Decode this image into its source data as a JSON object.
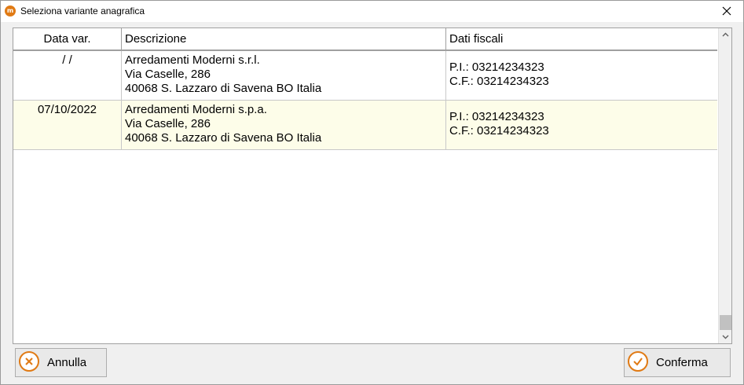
{
  "window": {
    "title": "Seleziona variante anagrafica"
  },
  "table": {
    "columns": [
      "Data var.",
      "Descrizione",
      "Dati fiscali"
    ],
    "rows": [
      {
        "date": " /  /",
        "description": [
          "Arredamenti Moderni s.r.l.",
          "Via Caselle, 286",
          "40068 S. Lazzaro di Savena BO Italia"
        ],
        "fiscal": [
          "P.I.: 03214234323",
          "C.F.: 03214234323"
        ],
        "selected": false
      },
      {
        "date": "07/10/2022",
        "description": [
          "Arredamenti Moderni s.p.a.",
          "Via Caselle, 286",
          "40068 S. Lazzaro di Savena BO Italia"
        ],
        "fiscal": [
          "P.I.: 03214234323",
          "C.F.: 03214234323"
        ],
        "selected": true
      }
    ]
  },
  "buttons": {
    "cancel_label": "Annulla",
    "confirm_label": "Conferma"
  },
  "colors": {
    "accent": "#e07a14",
    "selected_row": "#fdfde9",
    "grid_border": "#a0a0a0"
  }
}
